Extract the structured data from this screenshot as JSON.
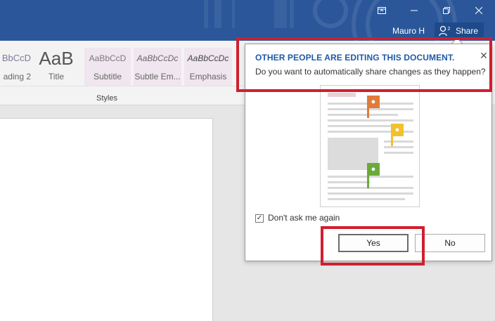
{
  "window": {
    "user": "Mauro H",
    "share_label": "Share",
    "share_icon": "person-share-icon",
    "controls": [
      "ribbon-display-icon",
      "minimize-icon",
      "restore-icon",
      "close-icon"
    ]
  },
  "ribbon": {
    "styles": [
      {
        "sample": "BbCcD",
        "name": "ading 2"
      },
      {
        "sample": "AaB",
        "name": "Title"
      },
      {
        "sample": "AaBbCcD",
        "name": "Subtitle"
      },
      {
        "sample": "AaBbCcDc",
        "name": "Subtle Em..."
      },
      {
        "sample": "AaBbCcDc",
        "name": "Emphasis"
      }
    ],
    "group_label": "Styles"
  },
  "dialog": {
    "title": "OTHER PEOPLE ARE EDITING THIS DOCUMENT.",
    "message": "Do you want to automatically share changes as they happen?",
    "checkbox_label": "Don't ask me again",
    "checkbox_checked": true,
    "yes_label": "Yes",
    "no_label": "No",
    "flag_colors": [
      "#e07b39",
      "#f2c12e",
      "#6aaa3a"
    ]
  },
  "annotation_color": "#d01f2f",
  "theme_color": "#2b579a"
}
